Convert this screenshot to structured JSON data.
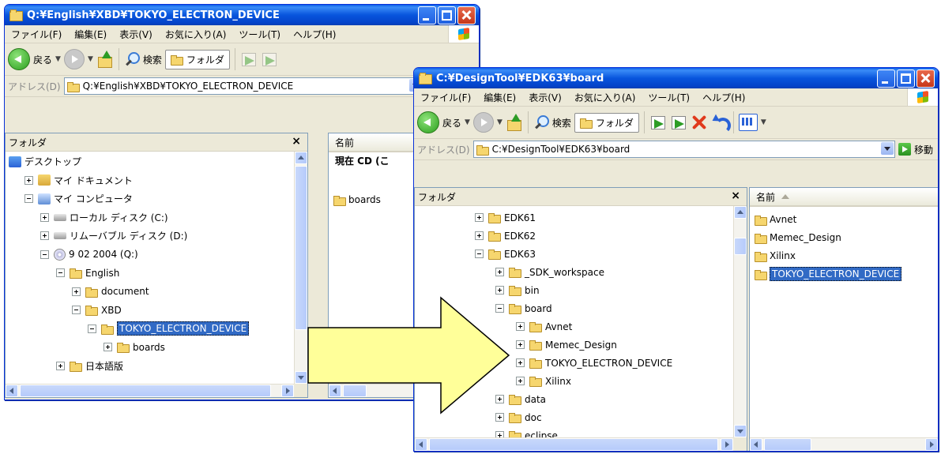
{
  "left_window": {
    "title": "Q:¥English¥XBD¥TOKYO_ELECTRON_DEVICE",
    "menu": [
      "ファイル(F)",
      "編集(E)",
      "表示(V)",
      "お気に入り(A)",
      "ツール(T)",
      "ヘルプ(H)"
    ],
    "toolbar": {
      "back": "戻る",
      "search": "検索",
      "folders": "フォルダ"
    },
    "address_label": "アドレス(D)",
    "address": "Q:¥English¥XBD¥TOKYO_ELECTRON_DEVICE",
    "folders_header": "フォルダ",
    "close_glyph": "×",
    "tree": [
      {
        "label": "デスクトップ",
        "icon": "desktop-icon",
        "depth": 0,
        "expander": "none"
      },
      {
        "label": "マイ ドキュメント",
        "icon": "documents-icon",
        "depth": 1,
        "expander": "plus"
      },
      {
        "label": "マイ コンピュータ",
        "icon": "computer-icon",
        "depth": 1,
        "expander": "minus"
      },
      {
        "label": "ローカル ディスク (C:)",
        "icon": "drive-icon",
        "depth": 2,
        "expander": "plus"
      },
      {
        "label": "リムーバブル ディスク (D:)",
        "icon": "drive-icon",
        "depth": 2,
        "expander": "plus"
      },
      {
        "label": "9 02 2004 (Q:)",
        "icon": "cd-icon",
        "depth": 2,
        "expander": "minus"
      },
      {
        "label": "English",
        "icon": "folder-icon",
        "depth": 3,
        "expander": "minus"
      },
      {
        "label": "document",
        "icon": "folder-icon",
        "depth": 4,
        "expander": "plus"
      },
      {
        "label": "XBD",
        "icon": "folder-icon",
        "depth": 4,
        "expander": "minus"
      },
      {
        "label": "TOKYO_ELECTRON_DEVICE",
        "icon": "folder-icon",
        "depth": 5,
        "expander": "minus",
        "selected": true
      },
      {
        "label": "boards",
        "icon": "folder-icon",
        "depth": 6,
        "expander": "plus"
      },
      {
        "label": "日本語版",
        "icon": "folder-icon",
        "depth": 3,
        "expander": "plus"
      }
    ],
    "list_header": "名前",
    "list_subheader": "現在 CD (こ",
    "list_items": [
      "boards"
    ]
  },
  "right_window": {
    "title": "C:¥DesignTool¥EDK63¥board",
    "menu": [
      "ファイル(F)",
      "編集(E)",
      "表示(V)",
      "お気に入り(A)",
      "ツール(T)",
      "ヘルプ(H)"
    ],
    "toolbar": {
      "back": "戻る",
      "search": "検索",
      "folders": "フォルダ"
    },
    "address_label": "アドレス(D)",
    "address": "C:¥DesignTool¥EDK63¥board",
    "go_label": "移動",
    "folders_header": "フォルダ",
    "close_glyph": "×",
    "tree": [
      {
        "label": "EDK61",
        "depth": 0,
        "expander": "plus"
      },
      {
        "label": "EDK62",
        "depth": 0,
        "expander": "plus"
      },
      {
        "label": "EDK63",
        "depth": 0,
        "expander": "minus"
      },
      {
        "label": "_SDK_workspace",
        "depth": 1,
        "expander": "plus"
      },
      {
        "label": "bin",
        "depth": 1,
        "expander": "plus"
      },
      {
        "label": "board",
        "depth": 1,
        "expander": "minus"
      },
      {
        "label": "Avnet",
        "depth": 2,
        "expander": "plus"
      },
      {
        "label": "Memec_Design",
        "depth": 2,
        "expander": "plus"
      },
      {
        "label": "TOKYO_ELECTRON_DEVICE",
        "depth": 2,
        "expander": "plus"
      },
      {
        "label": "Xilinx",
        "depth": 2,
        "expander": "plus"
      },
      {
        "label": "data",
        "depth": 1,
        "expander": "plus"
      },
      {
        "label": "doc",
        "depth": 1,
        "expander": "plus"
      },
      {
        "label": "eclipse",
        "depth": 1,
        "expander": "plus"
      }
    ],
    "list_header": "名前",
    "list_items": [
      {
        "label": "Avnet"
      },
      {
        "label": "Memec_Design"
      },
      {
        "label": "Xilinx"
      },
      {
        "label": "TOKYO_ELECTRON_DEVICE",
        "selected": true
      }
    ]
  },
  "colors": {
    "arrow_fill": "#ffff99",
    "arrow_stroke": "#000000",
    "selection": "#316ac5",
    "titlebar": "#0855dd"
  }
}
